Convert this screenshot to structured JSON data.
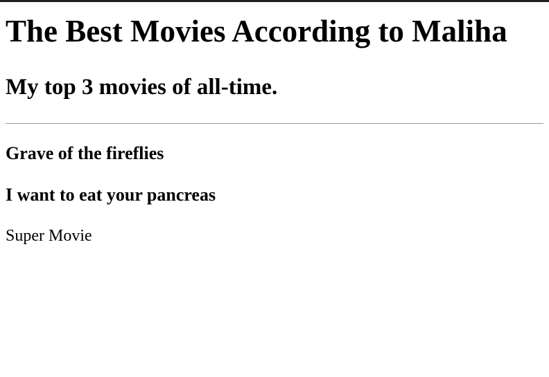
{
  "page": {
    "title": "The Best Movies According to Maliha",
    "subtitle": "My top 3 movies of all-time."
  },
  "movies": [
    {
      "title": "Grave of the fireflies"
    },
    {
      "title": "I want to eat your pancreas"
    }
  ],
  "note": "Super Movie"
}
